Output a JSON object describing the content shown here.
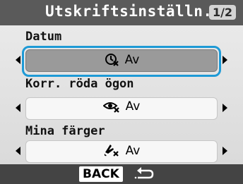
{
  "header": {
    "title": "Utskriftsinställn.",
    "page_indicator": "1/2"
  },
  "settings": [
    {
      "label": "Datum",
      "value": "Av",
      "icon": "date-icon",
      "selected": true
    },
    {
      "label": "Korr. röda ögon",
      "value": "Av",
      "icon": "red-eye-icon",
      "selected": false
    },
    {
      "label": "Mina färger",
      "value": "Av",
      "icon": "my-colors-icon",
      "selected": false
    }
  ],
  "footer": {
    "back_label": "BACK",
    "back_icon": "return-arrow-icon"
  },
  "colors": {
    "accent": "#1e9ad6",
    "header_bg": "#5a5a5a",
    "footer_bg": "#444444",
    "selected_bg": "#9a9a9a"
  }
}
